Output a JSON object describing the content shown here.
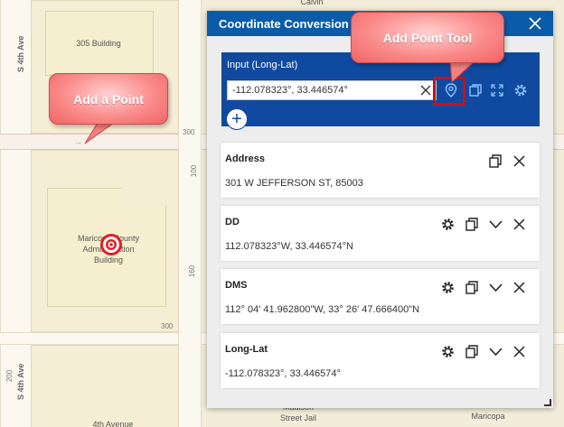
{
  "map": {
    "buildings": {
      "b305": "305 Building",
      "county_line1": "Maricopa County",
      "county_line2": "Administration",
      "county_line3": "Building",
      "jail_line1": "Madison",
      "jail_line2": "Street Jail",
      "avenue_bottom": "4th Avenue",
      "maricopa_bottom": "Maricopa",
      "calvin": "Calvin"
    },
    "streets": {
      "s4th_top": "S 4th Ave",
      "s4th_bottom": "S 4th Ave"
    },
    "numbers": {
      "n300_a": "300",
      "n100": "100",
      "n160": "160",
      "n300_b": "300",
      "n200": "200"
    }
  },
  "callouts": {
    "add_point": "Add a Point",
    "add_point_tool": "Add Point Tool"
  },
  "panel": {
    "title": "Coordinate Conversion",
    "input": {
      "label": "Input (Long-Lat)",
      "value": "-112.078323°, 33.446574°"
    },
    "cards": [
      {
        "title": "Address",
        "value": "301 W JEFFERSON ST, 85003"
      },
      {
        "title": "DD",
        "value": "112.078323°W, 33.446574°N"
      },
      {
        "title": "DMS",
        "value": "112° 04' 41.962800\"W, 33° 26' 47.666400\"N"
      },
      {
        "title": "Long-Lat",
        "value": "-112.078323°, 33.446574°"
      }
    ]
  },
  "colors": {
    "header_blue": "#0a5ca8",
    "input_blue": "#0f4aa0",
    "highlight_red": "#c2131e",
    "callout_pink": "#fa8b8b"
  },
  "icons": [
    "close-icon",
    "clear-icon",
    "map-pin-icon",
    "copy-icon",
    "expand-icon",
    "gear-icon",
    "chevron-down-icon",
    "plus-icon",
    "target-marker-icon"
  ]
}
